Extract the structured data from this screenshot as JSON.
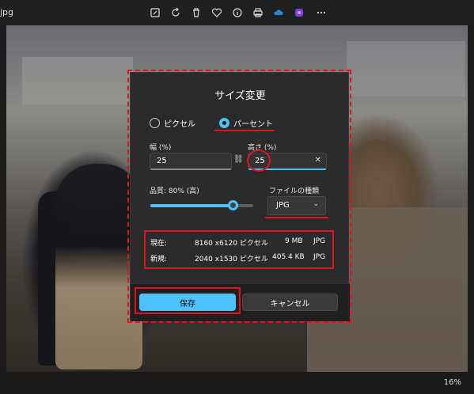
{
  "window": {
    "filename": "jpg"
  },
  "toolbar": {
    "icons": [
      "edit-image-icon",
      "rotate-icon",
      "delete-icon",
      "favorite-icon",
      "info-icon",
      "print-icon",
      "onedrive-icon",
      "clipchamp-icon",
      "more-icon"
    ]
  },
  "dialog": {
    "title": "サイズ変更",
    "modes": {
      "pixel": "ピクセル",
      "percent": "パーセント",
      "selected": "percent"
    },
    "width": {
      "label": "幅 (%)",
      "value": "25"
    },
    "height": {
      "label": "高さ (%)",
      "value": "25"
    },
    "quality": {
      "label": "品質: 80% (高)",
      "level": 0.8
    },
    "filetype": {
      "label": "ファイルの種類",
      "value": "JPG"
    },
    "current": {
      "label": "現在:",
      "dims": "8160 x6120 ピクセル",
      "size": "9 MB",
      "type": "JPG"
    },
    "new": {
      "label": "新規:",
      "dims": "2040 x1530 ピクセル",
      "size": "405.4 KB",
      "type": "JPG"
    },
    "save_label": "保存",
    "cancel_label": "キャンセル"
  },
  "status": {
    "zoom": "16%"
  },
  "colors": {
    "accent": "#4cc2ff",
    "annotation": "#e0141e"
  }
}
